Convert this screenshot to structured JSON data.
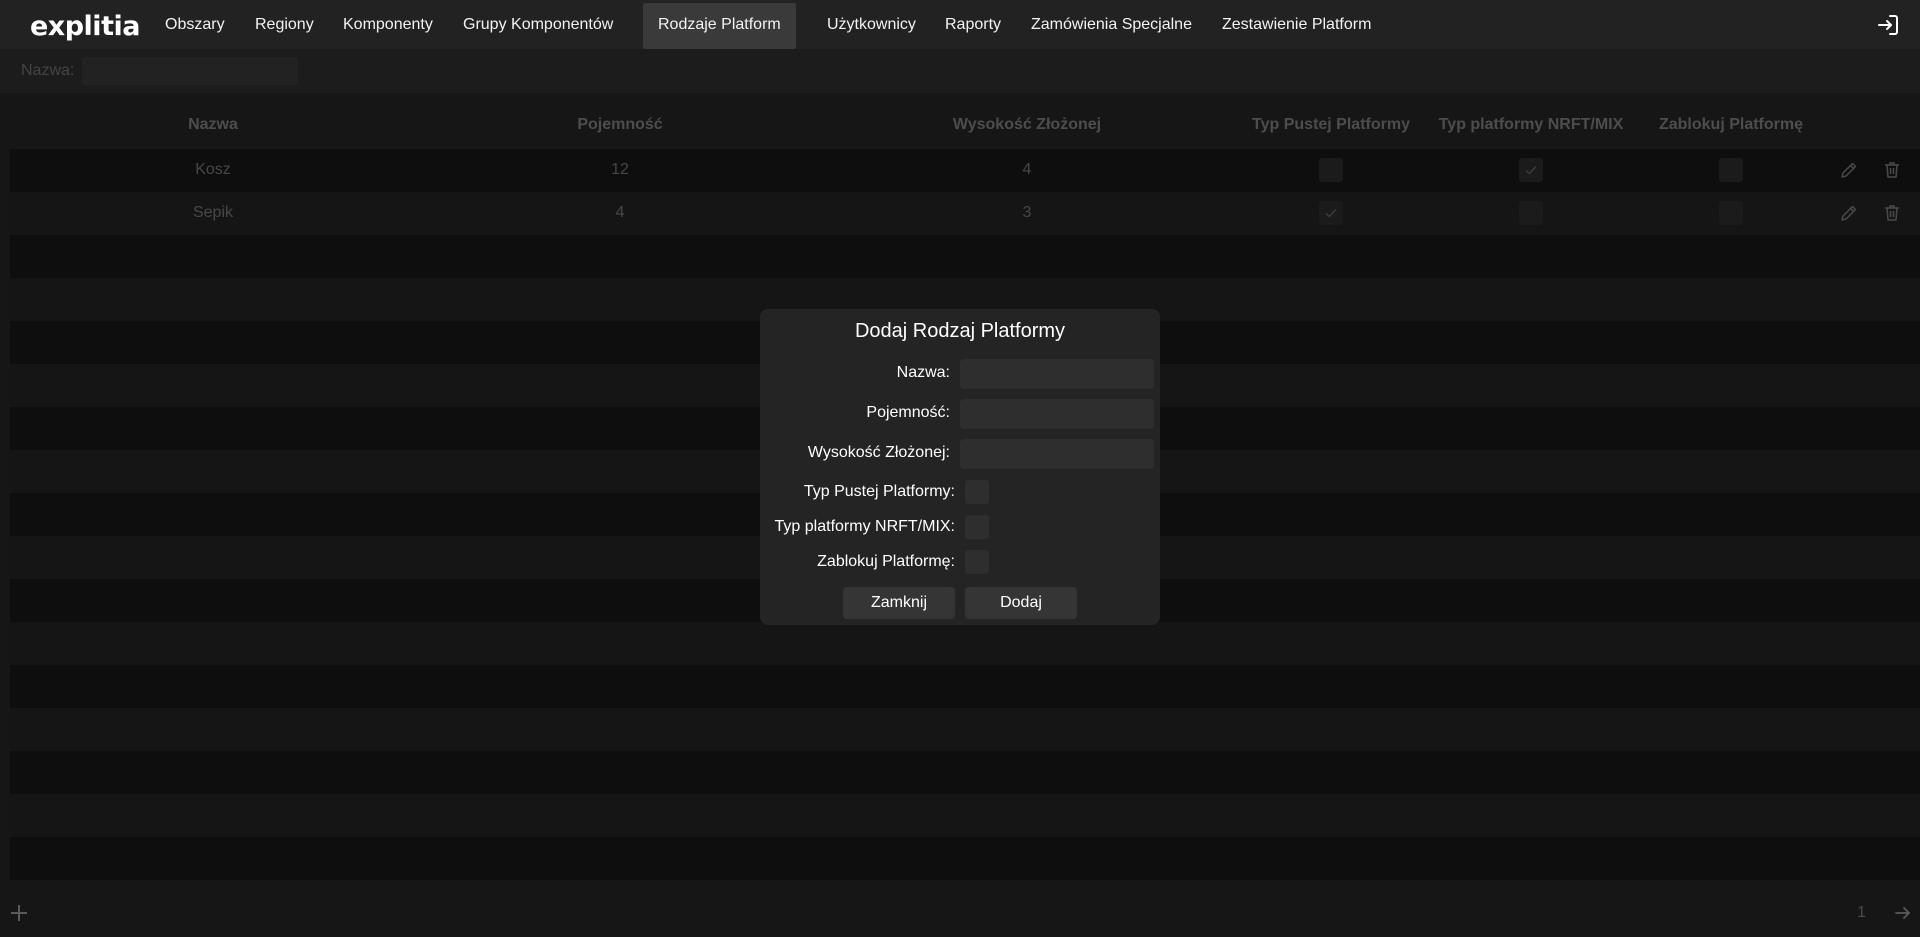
{
  "brand": {
    "logo": "explitia"
  },
  "nav": {
    "items": [
      {
        "label": "Obszary",
        "active": false
      },
      {
        "label": "Regiony",
        "active": false
      },
      {
        "label": "Komponenty",
        "active": false
      },
      {
        "label": "Grupy Komponentów",
        "active": false
      },
      {
        "label": "Rodzaje Platform",
        "active": true
      },
      {
        "label": "Użytkownicy",
        "active": false
      },
      {
        "label": "Raporty",
        "active": false
      },
      {
        "label": "Zamówienia Specjalne",
        "active": false
      },
      {
        "label": "Zestawienie Platform",
        "active": false
      }
    ],
    "logout_icon": "logout-icon"
  },
  "filter": {
    "label": "Nazwa:",
    "value": ""
  },
  "table": {
    "headers": [
      "Nazwa",
      "Pojemność",
      "Wysokość Złożonej",
      "Typ Pustej Platformy",
      "Typ platformy NRFT/MIX",
      "Zablokuj Platformę"
    ],
    "rows": [
      {
        "name": "Kosz",
        "capacity": "12",
        "height": "4",
        "empty_type": false,
        "nrft_mix": true,
        "locked": false
      },
      {
        "name": "Sepik",
        "capacity": "4",
        "height": "3",
        "empty_type": true,
        "nrft_mix": false,
        "locked": false
      }
    ]
  },
  "pagination": {
    "page": "1"
  },
  "modal": {
    "title": "Dodaj Rodzaj Platformy",
    "fields": {
      "name_label": "Nazwa:",
      "name_value": "",
      "capacity_label": "Pojemność:",
      "capacity_value": "",
      "height_label": "Wysokość Złożonej:",
      "height_value": "",
      "empty_type_label": "Typ Pustej Platformy:",
      "empty_type_checked": false,
      "nrft_mix_label": "Typ platformy NRFT/MIX:",
      "nrft_mix_checked": false,
      "locked_label": "Zablokuj Platformę:",
      "locked_checked": false
    },
    "close_label": "Zamknij",
    "add_label": "Dodaj"
  },
  "colors": {
    "background": "#161616",
    "navbar": "#222222",
    "modal": "#242424",
    "active_tab": "#3a3a3a"
  }
}
